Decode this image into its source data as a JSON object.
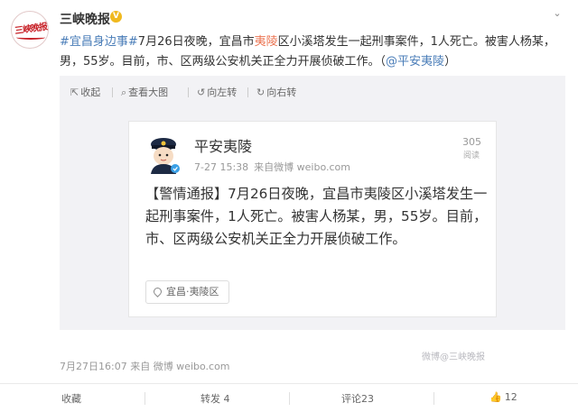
{
  "account": {
    "name": "三峡晚报",
    "logo_text": "三峡晚报"
  },
  "post": {
    "hashtag": "#宜昌身边事#",
    "text_a": "7月26日夜晚，宜昌市",
    "text_link": "夷陵",
    "text_b": "区小溪塔发生一起刑事案件，1人死亡。被害人杨某，",
    "text_c": "男，55岁。目前，市、区两级公安机关正全力开展侦破工作。（",
    "mention": "@平安夷陵",
    "text_end": "）"
  },
  "toolbar": {
    "collapse": "收起",
    "view_large": "查看大图",
    "rotate_left": "向左转",
    "rotate_right": "向右转"
  },
  "card": {
    "name": "平安夷陵",
    "date": "7-27 15:38",
    "source": "来自微博 weibo.com",
    "count": "305",
    "count_label": "阅读",
    "body": "【警情通报】7月26日夜晚，宜昌市夷陵区小溪塔发生一起刑事案件，1人死亡。被害人杨某，男，55岁。目前，市、区两级公安机关正全力开展侦破工作。",
    "location": "宜昌·夷陵区",
    "watermark": "微博@三峡晚报"
  },
  "timestamp": "7月27日16:07 来自 微博 weibo.com",
  "actions": {
    "favorite": "收藏",
    "repost": "转发 4",
    "comment": "评论23",
    "like": "12"
  },
  "colors": {
    "accent": "#eb7350",
    "link_blue": "#4a7db8",
    "badge": "#f0b91f"
  },
  "icons": [
    "verified-icon",
    "chevron-down-icon",
    "collapse-icon",
    "zoom-icon",
    "rotate-left-icon",
    "rotate-right-icon",
    "location-pin-icon",
    "thumbs-up-icon"
  ]
}
